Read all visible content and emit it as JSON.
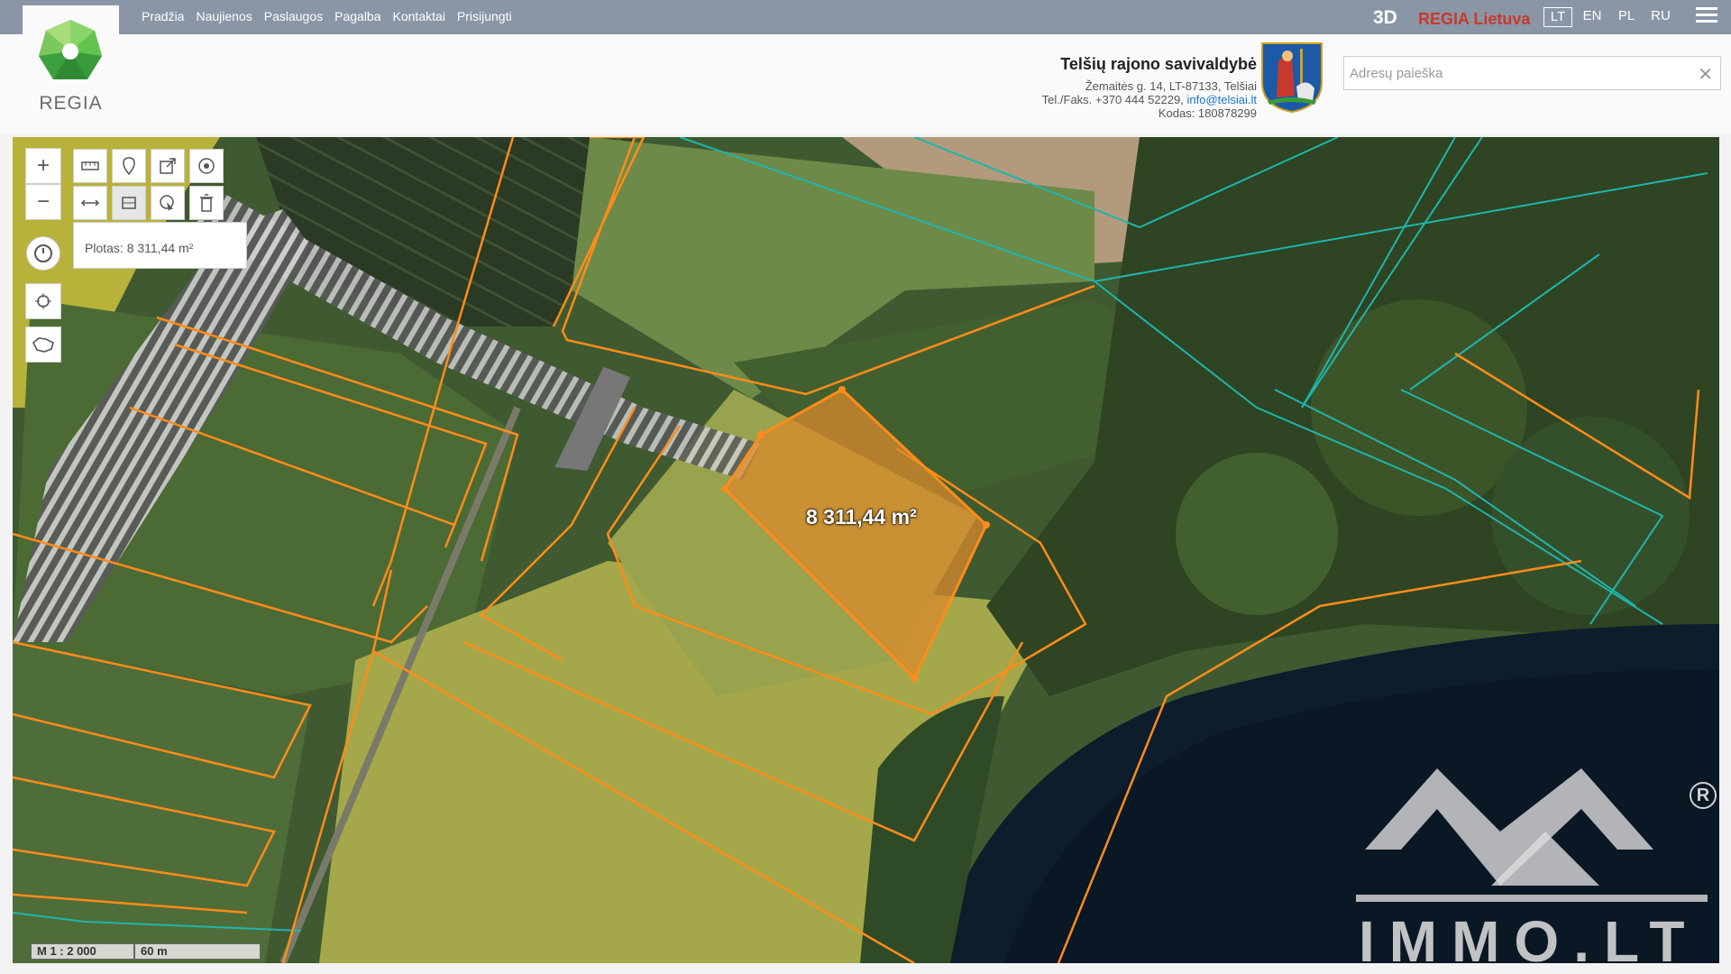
{
  "logo": {
    "text": "REGIA"
  },
  "nav": [
    "Pradžia",
    "Naujienos",
    "Paslaugos",
    "Pagalba",
    "Kontaktai",
    "Prisijungti"
  ],
  "topbar": {
    "three_d": "3D",
    "regia_lietuva": "REGIA Lietuva",
    "languages": [
      "LT",
      "EN",
      "PL",
      "RU"
    ],
    "active_language": "LT"
  },
  "municipality": {
    "name": "Telšių rajono savivaldybė",
    "address": "Žemaitės g. 14, LT-87133, Telšiai",
    "phone": "Tel./Faks. +370 444 52229,",
    "email": "info@telsiai.lt",
    "code": "Kodas: 180878299"
  },
  "search": {
    "placeholder": "Adresų paieška",
    "value": ""
  },
  "map": {
    "area_info": "Plotas: 8 311,44 m²",
    "area_label": "8 311,44 m²",
    "scale_ratio": "M 1 : 2 000",
    "scale_distance": "60 m",
    "watermark": "IMMO.LT",
    "watermark_reg": "R",
    "colors": {
      "parcel_orange": "#ff8c1a",
      "parcel_teal": "#1fb5ad",
      "selected_fill": "#d98a2c",
      "water": "#0d1d2c"
    }
  }
}
